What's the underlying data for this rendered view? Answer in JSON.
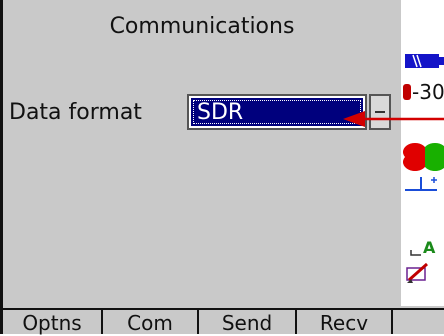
{
  "title": "Communications",
  "form": {
    "data_format_label": "Data format",
    "data_format_value": "SDR"
  },
  "status_bar": {
    "temperature_text": "-30",
    "a_label": "A"
  },
  "softkeys": [
    "Optns",
    "Com",
    "Send",
    "Recv"
  ],
  "colors": {
    "screen_bg": "#c9c9c9",
    "selection_bg": "#00007d",
    "arrow": "#d30000",
    "battery": "#1414c8"
  }
}
